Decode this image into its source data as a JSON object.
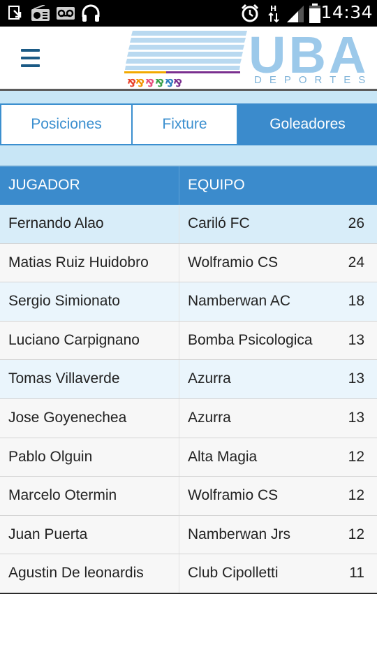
{
  "status_bar": {
    "time": "14:34",
    "icons": [
      "download-notification-icon",
      "radio-icon",
      "voicemail-icon",
      "headset-icon",
      "alarm-icon",
      "data-arrows-icon",
      "signal-icon",
      "battery-icon"
    ]
  },
  "header": {
    "logo_text": "UBA",
    "logo_subtext": "DEPORTES",
    "menu_icon": "hamburger-menu-icon"
  },
  "tabs": [
    {
      "label": "Posiciones",
      "active": false
    },
    {
      "label": "Fixture",
      "active": false
    },
    {
      "label": "Goleadores",
      "active": true
    }
  ],
  "table": {
    "headers": {
      "player": "JUGADOR",
      "team": "EQUIPO"
    },
    "rows": [
      {
        "player": "Fernando Alao",
        "team": "Cariló FC",
        "goals": "26"
      },
      {
        "player": "Matias Ruiz Huidobro",
        "team": "Wolframio CS",
        "goals": "24"
      },
      {
        "player": "Sergio Simionato",
        "team": "Namberwan AC",
        "goals": "18"
      },
      {
        "player": "Luciano Carpignano",
        "team": "Bomba Psicologica",
        "goals": "13"
      },
      {
        "player": "Tomas Villaverde",
        "team": "Azurra",
        "goals": "13"
      },
      {
        "player": "Jose Goyenechea",
        "team": "Azurra",
        "goals": "13"
      },
      {
        "player": "Pablo Olguin",
        "team": "Alta Magia",
        "goals": "12"
      },
      {
        "player": "Marcelo Otermin",
        "team": "Wolframio CS",
        "goals": "12"
      },
      {
        "player": "Juan Puerta",
        "team": "Namberwan Jrs",
        "goals": "12"
      },
      {
        "player": "Agustin De leonardis",
        "team": "Club Cipolletti",
        "goals": "11"
      }
    ]
  },
  "colors": {
    "accent": "#3b8bcc",
    "logo": "#9cc9ea",
    "band": "#c8e6f6",
    "menu": "#1b5a85"
  }
}
